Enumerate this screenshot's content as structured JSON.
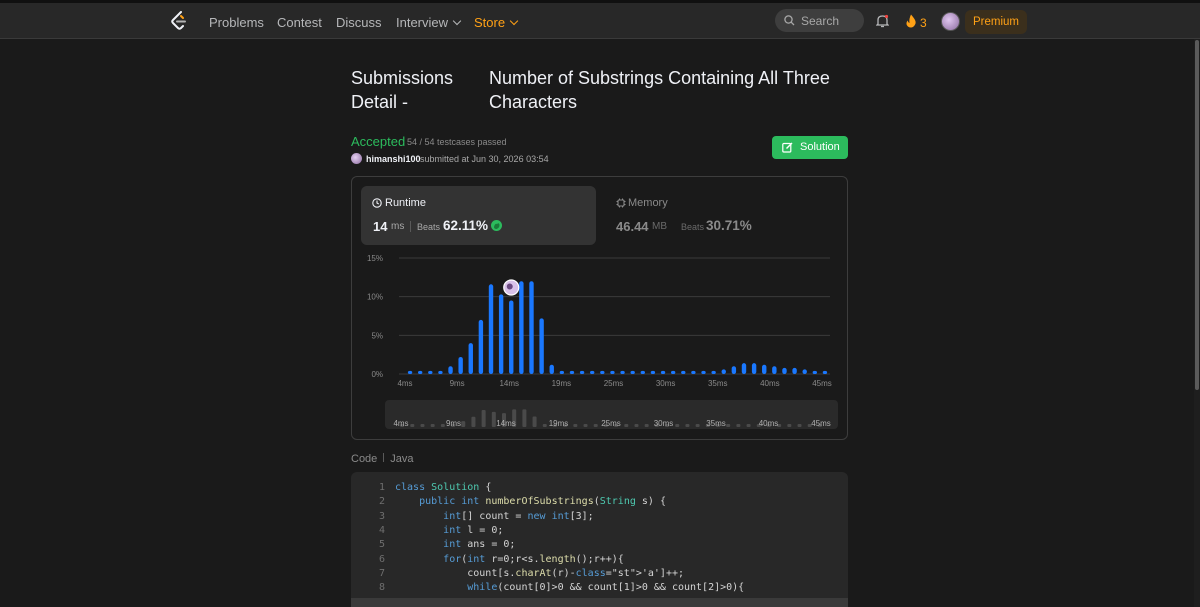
{
  "nav": {
    "links": [
      "Problems",
      "Contest",
      "Discuss",
      "Interview",
      "Store"
    ],
    "search_placeholder": "Search",
    "streak": "3",
    "premium": "Premium"
  },
  "header": {
    "title_left": "Submissions Detail -",
    "title_right": "Number of Substrings Containing All Three Characters"
  },
  "submission": {
    "status": "Accepted",
    "testcases": "54 / 54 testcases passed",
    "user": "himanshi100",
    "submitted": "submitted at Jun 30, 2026 03:54",
    "solution_button": "Solution",
    "status_color": "#2cbb5d"
  },
  "runtime": {
    "label": "Runtime",
    "value": "14",
    "unit": "ms",
    "beats_label": "Beats",
    "beats": "62.11%"
  },
  "memory": {
    "label": "Memory",
    "value": "46.44",
    "unit": "MB",
    "beats_label": "Beats",
    "beats": "30.71%"
  },
  "chart_data": {
    "type": "bar",
    "ylabel": "",
    "xlabel": "",
    "yticks": [
      "15%",
      "10%",
      "5%",
      "0%"
    ],
    "ylim": [
      0,
      15
    ],
    "xtick_labels": [
      "4ms",
      "9ms",
      "14ms",
      "19ms",
      "25ms",
      "30ms",
      "35ms",
      "40ms",
      "45ms"
    ],
    "values": [
      0.4,
      0.4,
      0.4,
      0.4,
      1.0,
      2.2,
      4.0,
      7.0,
      11.6,
      10.3,
      9.5,
      12.0,
      12.0,
      7.2,
      1.2,
      0.4,
      0.4,
      0.4,
      0.4,
      0.4,
      0.4,
      0.4,
      0.4,
      0.4,
      0.4,
      0.4,
      0.4,
      0.4,
      0.4,
      0.4,
      0.4,
      0.6,
      1.0,
      1.4,
      1.4,
      1.2,
      1.0,
      0.8,
      0.8,
      0.6,
      0.4,
      0.4
    ],
    "highlight_index": 10,
    "bar_color": "#1a78ff",
    "grid": true,
    "brush_labels": [
      "4ms",
      "9ms",
      "14ms",
      "19ms",
      "25ms",
      "30ms",
      "35ms",
      "40ms",
      "45ms"
    ]
  },
  "code": {
    "label": "Code",
    "language": "Java",
    "lines": [
      {
        "n": "1",
        "t": "class Solution {"
      },
      {
        "n": "2",
        "t": "    public int numberOfSubstrings(String s) {"
      },
      {
        "n": "3",
        "t": "        int[] count = new int[3];"
      },
      {
        "n": "4",
        "t": "        int l = 0;"
      },
      {
        "n": "5",
        "t": "        int ans = 0;"
      },
      {
        "n": "6",
        "t": "        for(int r=0;r<s.length();r++){"
      },
      {
        "n": "7",
        "t": "            count[s.charAt(r)-'a']++;"
      },
      {
        "n": "8",
        "t": "            while(count[0]>0 && count[1]>0 && count[2]>0){"
      }
    ]
  }
}
